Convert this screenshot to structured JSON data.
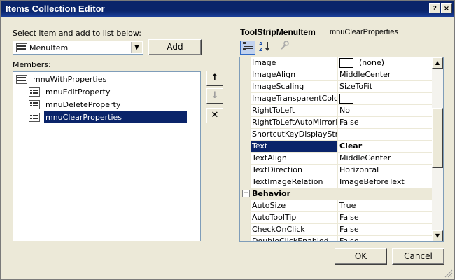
{
  "window": {
    "title": "Items Collection Editor",
    "help_label": "?",
    "close_label": "×"
  },
  "left": {
    "select_label": "Select item and add to list below:",
    "combo_value": "MenuItem",
    "add_label": "Add",
    "members_label": "Members:",
    "tree": {
      "root": "mnuWithProperties",
      "children": [
        "mnuEditProperty",
        "mnuDeleteProperty",
        "mnuClearProperties"
      ],
      "selected_index": 2
    },
    "move_up_icon": "↑",
    "move_down_icon": "↓",
    "delete_icon": "✕"
  },
  "properties": {
    "object_type": "ToolStripMenuItem",
    "object_name": "mnuClearProperties",
    "rows": [
      {
        "name": "Image",
        "value": "(none)",
        "swatch": true
      },
      {
        "name": "ImageAlign",
        "value": "MiddleCenter"
      },
      {
        "name": "ImageScaling",
        "value": "SizeToFit"
      },
      {
        "name": "ImageTransparentColor",
        "value": "",
        "swatch": true
      },
      {
        "name": "RightToLeft",
        "value": "No"
      },
      {
        "name": "RightToLeftAutoMirrorIm",
        "value": "False"
      },
      {
        "name": "ShortcutKeyDisplayString",
        "value": ""
      },
      {
        "name": "Text",
        "value": "Clear",
        "selected": true
      },
      {
        "name": "TextAlign",
        "value": "MiddleCenter"
      },
      {
        "name": "TextDirection",
        "value": "Horizontal"
      },
      {
        "name": "TextImageRelation",
        "value": "ImageBeforeText"
      },
      {
        "category": "Behavior",
        "toggle": "−"
      },
      {
        "name": "AutoSize",
        "value": "True"
      },
      {
        "name": "AutoToolTip",
        "value": "False"
      },
      {
        "name": "CheckOnClick",
        "value": "False"
      },
      {
        "name": "DoubleClickEnabled",
        "value": "False"
      }
    ]
  },
  "buttons": {
    "ok": "OK",
    "cancel": "Cancel"
  }
}
